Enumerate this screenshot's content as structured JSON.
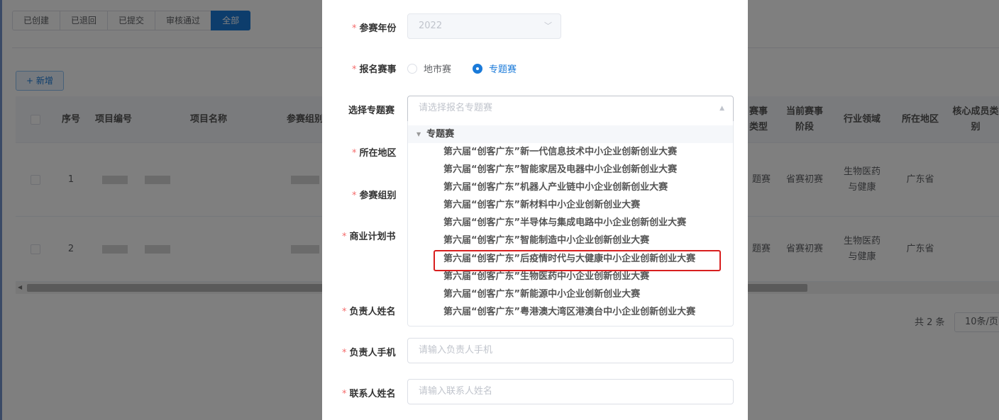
{
  "tabs": [
    "已创建",
    "已退回",
    "已提交",
    "审核通过",
    "全部"
  ],
  "add_button": "+ 新增",
  "table": {
    "headers": {
      "index": "序号",
      "project_code": "项目编号",
      "project_name": "项目名称",
      "group": "参赛组别",
      "event_type": "赛事类型",
      "current_stage": "当前赛事阶段",
      "industry": "行业领域",
      "region": "所在地区",
      "core_member": "核心成员类别"
    },
    "rows": [
      {
        "index": "1",
        "event_type": "题赛",
        "current_stage": "省赛初赛",
        "industry": "生物医药与健康",
        "region": "广东省"
      },
      {
        "index": "2",
        "event_type": "题赛",
        "current_stage": "省赛初赛",
        "industry": "生物医药与健康",
        "region": "广东省"
      }
    ]
  },
  "pager": {
    "total": "共 2 条",
    "page_size": "10条/页"
  },
  "form": {
    "year_label": "参赛年份",
    "year_value": "2022",
    "event_label": "报名赛事",
    "event_options": [
      "地市赛",
      "专题赛"
    ],
    "event_selected": "专题赛",
    "topic_label": "选择专题赛",
    "topic_placeholder": "请选择报名专题赛",
    "region_label": "所在地区",
    "group_label": "参赛组别",
    "plan_label": "商业计划书",
    "leader_name_label": "负责人姓名",
    "leader_phone_label": "负责人手机",
    "leader_phone_placeholder": "请输入负责人手机",
    "contact_name_label": "联系人姓名",
    "contact_name_placeholder": "请输入联系人姓名"
  },
  "dropdown": {
    "group_title": "专题赛",
    "options": [
      "第六届“创客广东”新一代信息技术中小企业创新创业大赛",
      "第六届“创客广东”智能家居及电器中小企业创新创业大赛",
      "第六届“创客广东”机器人产业链中小企业创新创业大赛",
      "第六届“创客广东”新材料中小企业创新创业大赛",
      "第六届“创客广东”半导体与集成电路中小企业创新创业大赛",
      "第六届“创客广东”智能制造中小企业创新创业大赛",
      "第六届“创客广东”后疫情时代与大健康中小企业创新创业大赛",
      "第六届“创客广东”生物医药中小企业创新创业大赛",
      "第六届“创客广东”新能源中小企业创新创业大赛",
      "第六届“创客广东”粤港澳大湾区港澳台中小企业创新创业大赛"
    ],
    "highlighted_index": 6
  },
  "colors": {
    "primary": "#1a7ad9",
    "required": "#f56c6c",
    "highlight_border": "#d81e1e"
  }
}
